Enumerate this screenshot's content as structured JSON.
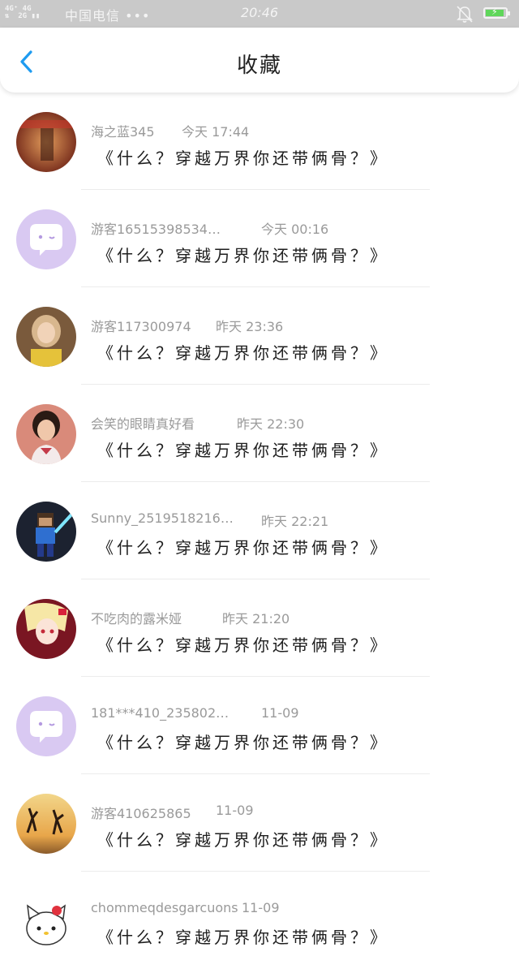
{
  "status_bar": {
    "signal_text": "4G⁺ 4G\n2G",
    "carrier": "中国电信 •••",
    "time": "20:46",
    "icons": [
      "signal-icon",
      "bell-off-icon",
      "battery-charging-icon"
    ],
    "battery_color": "#5fd65a"
  },
  "nav": {
    "title": "收藏",
    "back_icon": "chevron-left-icon",
    "accent": "#1e9bf0"
  },
  "items": [
    {
      "name": "海之蓝345",
      "time": "今天 17:44",
      "message": "《什么？穿越万界你还带俩骨？》",
      "avatar": "photo-tunnel"
    },
    {
      "name": "游客16515398534…",
      "time": "今天 00:16",
      "message": "《什么？穿越万界你还带俩骨？》",
      "avatar": "default-purple"
    },
    {
      "name": "游客117300974",
      "time": "昨天 23:36",
      "message": "《什么？穿越万界你还带俩骨？》",
      "avatar": "photo-girl-yellow"
    },
    {
      "name": "会笑的眼睛真好看",
      "time": "昨天 22:30",
      "message": "《什么？穿越万界你还带俩骨？》",
      "avatar": "photo-girl"
    },
    {
      "name": "Sunny_2519518216…",
      "time": "昨天 22:21",
      "message": "《什么？穿越万界你还带俩骨？》",
      "avatar": "photo-pixel-hero"
    },
    {
      "name": "不吃肉的露米娅",
      "time": "昨天 21:20",
      "message": "《什么？穿越万界你还带俩骨？》",
      "avatar": "photo-anime"
    },
    {
      "name": "181***410_235802…",
      "time": "11-09",
      "message": "《什么？穿越万界你还带俩骨？》",
      "avatar": "default-purple"
    },
    {
      "name": "游客410625865",
      "time": "11-09",
      "message": "《什么？穿越万界你还带俩骨？》",
      "avatar": "photo-sunset-jump"
    },
    {
      "name": "chommeqdesgarcuons",
      "time": "11-09",
      "message": "《什么？穿越万界你还带俩骨？》",
      "avatar": "photo-hello-kitty"
    }
  ]
}
